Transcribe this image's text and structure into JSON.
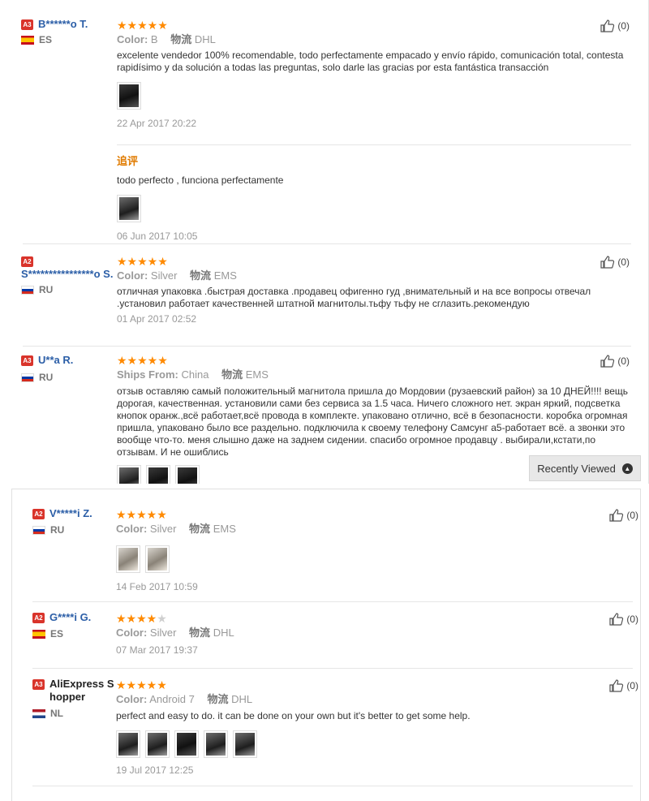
{
  "reviews_top": [
    {
      "level": "A3",
      "name": "B******o T.",
      "flag": "es",
      "country": "ES",
      "stars": 5,
      "attr_label": "Color:",
      "attr_value": "B",
      "ship_label": "物流",
      "ship_value": "DHL",
      "text": "excelente vendedor 100% recomendable, todo perfectamente empacado y envío rápido, comunicación total, contesta rapidísimo y da solución a todas las preguntas, solo darle las gracias por esta fantástica transacción",
      "images": 1,
      "date": "22 Apr 2017 20:22",
      "likes": "(0)",
      "followup": {
        "label": "追评",
        "text": "todo perfecto , funciona perfectamente",
        "images": 1,
        "date": "06 Jun 2017 10:05"
      }
    },
    {
      "level": "A2",
      "name": "S****************o S.",
      "flag": "ru",
      "country": "RU",
      "stars": 5,
      "attr_label": "Color:",
      "attr_value": "Silver",
      "ship_label": "物流",
      "ship_value": "EMS",
      "text": "отличная упаковка .быстрая доставка .продавец офигенно гуд ,внимательный и на все вопросы отвечал .установил работает качественней штатной магнитолы.тьфу тьфу не сглазить.рекомендую",
      "date": "01 Apr 2017 02:52",
      "likes": "(0)"
    },
    {
      "level": "A3",
      "name": "U**a R.",
      "flag": "ru",
      "country": "RU",
      "stars": 5,
      "attr_label": "Ships From:",
      "attr_value": "China",
      "ship_label": "物流",
      "ship_value": "EMS",
      "text": "отзыв оставляю самый положительный магнитола пришла до Мордовии (рузаевский район) за 10 ДНЕЙ!!!! вещь дорогая, качественная. установили сами без сервиса за 1.5 часа. Ничего сложного нет. экран яркий, подсветка кнопок оранж.,всё работает,всё провода в комплекте. упаковано отлично, всё в безопасности. коробка огромная пришла, упаковано было все раздельно. подключила к своему телефону Самсунг а5-работает всё. а звонки это вообще что-то. меня слышно даже на заднем сидении. спасибо огромное продавцу . выбирали,кстати,по отзывам. И не ошиблись",
      "likes": "(0)"
    }
  ],
  "recently_viewed": {
    "label": "Recently Viewed",
    "icon": "chevron-up-icon"
  },
  "reviews_bottom": [
    {
      "level": "A2",
      "name": "V*****i Z.",
      "flag": "ru",
      "country": "RU",
      "stars": 5,
      "attr_label": "Color:",
      "attr_value": "Silver",
      "ship_label": "物流",
      "ship_value": "EMS",
      "images": 2,
      "date": "14 Feb 2017 10:59",
      "likes": "(0)"
    },
    {
      "level": "A2",
      "name": "G****i G.",
      "flag": "es",
      "country": "ES",
      "stars": 4,
      "attr_label": "Color:",
      "attr_value": "Silver",
      "ship_label": "物流",
      "ship_value": "DHL",
      "date": "07 Mar 2017 19:37",
      "likes": "(0)"
    },
    {
      "level": "A3",
      "name": "AliExpress Shopper",
      "flag": "nl",
      "country": "NL",
      "stars": 5,
      "attr_label": "Color:",
      "attr_value": "Android 7",
      "ship_label": "物流",
      "ship_value": "DHL",
      "text": "perfect and easy to do. it can be done on your own but it's better to get some help.",
      "images": 5,
      "date": "19 Jul 2017 12:25",
      "likes": "(0)"
    }
  ],
  "colors": {
    "stars": "#ff8a00",
    "buyer_name": "#2b5ea7",
    "badge": "#d9342b",
    "followup": "#e07b00"
  }
}
